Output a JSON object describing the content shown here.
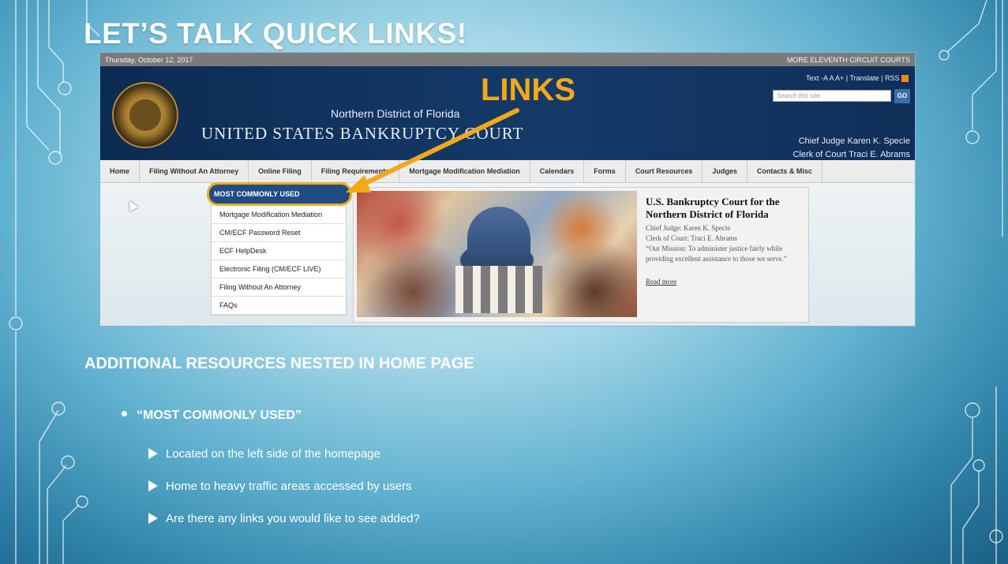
{
  "slide": {
    "title": "LET’S TALK QUICK LINKS!",
    "section_heading": "ADDITIONAL RESOURCES NESTED IN HOME PAGE",
    "bullet": "“MOST COMMONLY USED”",
    "sub_bullets": [
      "Located on the left side of the homepage",
      "Home to heavy traffic areas accessed by users",
      "Are there any links you would like to see added?"
    ]
  },
  "site": {
    "date": "Thursday, October 12, 2017",
    "more_courts": "MORE ELEVENTH CIRCUIT COURTS",
    "utility": "Text  -A  A  A+  |  Translate  |  RSS",
    "search_placeholder": "Search this site",
    "go_label": "GO",
    "district": "Northern District of Florida",
    "court_name": "UNITED STATES BANKRUPTCY COURT",
    "callout": "LINKS",
    "chief_judge": "Chief Judge Karen K. Specie",
    "clerk": "Clerk of Court Traci E. Abrams",
    "nav": [
      "Home",
      "Filing Without An Attorney",
      "Online Filing",
      "Filing Requirements",
      "Mortgage Modification Mediation",
      "Calendars",
      "Forms",
      "Court Resources",
      "Judges",
      "Contacts & Misc"
    ],
    "menu_heading": "MOST COMMONLY USED",
    "menu_items": [
      "Mortgage Modification Mediation",
      "CM/ECF Password Reset",
      "ECF HelpDesk",
      "Electronic Filing (CM/ECF LIVE)",
      "Filing Without An Attorney",
      "FAQs"
    ],
    "feature_title": "U.S. Bankruptcy Court for the Northern District of Florida",
    "feature_judge": "Chief Judge: Karen K. Specie",
    "feature_clerk": "Clerk of Court: Traci E. Abrams",
    "feature_mission": "“Our Mission: To administer justice fairly while providing excellent assistance to those we serve.”",
    "read_more": "Read more"
  },
  "colors": {
    "callout": "#f2a818",
    "banner": "#0c2b52",
    "menu_head": "#1f4c85"
  }
}
